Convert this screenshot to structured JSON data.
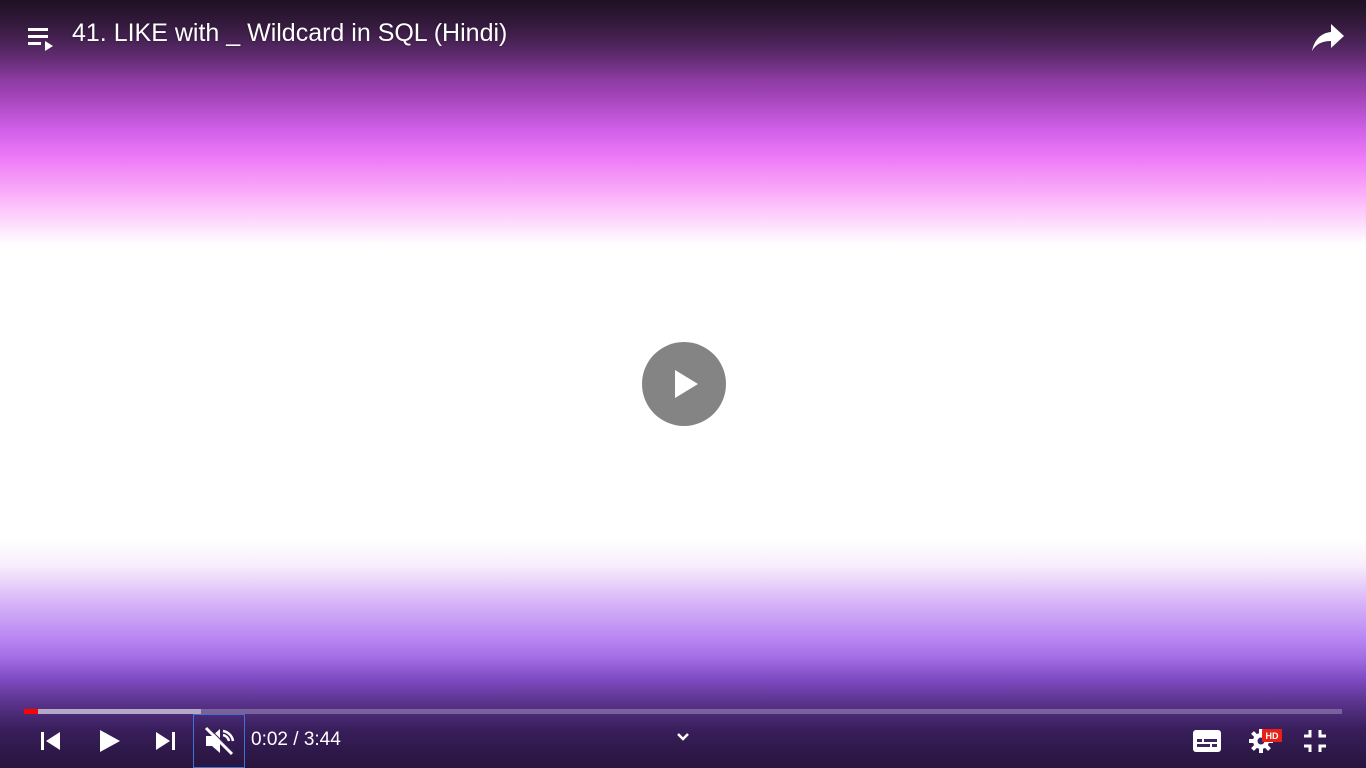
{
  "video": {
    "title": "41. LIKE with _ Wildcard in SQL (Hindi)"
  },
  "top_bar": {
    "playlist_icon": "playlist-play-icon",
    "share_icon": "share-arrow-icon"
  },
  "center": {
    "play_icon": "play-icon"
  },
  "progress": {
    "played_fraction": 0.011,
    "buffered_fraction": 0.134,
    "played_color": "#ff0000"
  },
  "controls": {
    "time_display": "0:02 / 3:44",
    "quality_badge": "HD",
    "icons": [
      "previous-icon",
      "play-icon",
      "next-icon",
      "muted-speaker-icon",
      "chevron-down-icon",
      "subtitles-icon",
      "settings-gear-icon",
      "exit-fullscreen-icon"
    ],
    "badge_color": "#e62117",
    "mute_focus_color": "#3f72d9"
  }
}
